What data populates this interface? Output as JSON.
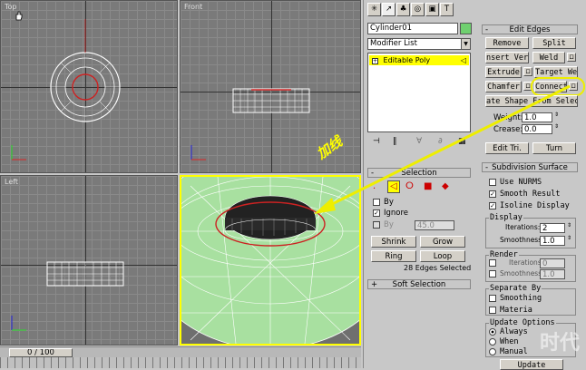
{
  "viewports": {
    "top": {
      "label": "Top"
    },
    "front": {
      "label": "Front"
    },
    "left": {
      "label": "Left"
    }
  },
  "timeline": {
    "frame": "0 / 100"
  },
  "object": {
    "name": "Cylinder01",
    "color": "#6fd06f"
  },
  "modifier_list": {
    "label": "Modifier List"
  },
  "stack": {
    "item": "Editable Poly"
  },
  "annotation": {
    "text": "加线"
  },
  "selection": {
    "title": "Selection",
    "by_vertex": "By",
    "ignore_backfacing": "Ignore",
    "by_angle": "By",
    "angle_value": "45.0",
    "shrink": "Shrink",
    "grow": "Grow",
    "ring": "Ring",
    "loop": "Loop",
    "status": "28 Edges Selected"
  },
  "soft_selection": {
    "title": "Soft Selection"
  },
  "edit_edges": {
    "title": "Edit Edges",
    "remove": "Remove",
    "split": "Split",
    "insert_vertex": "nsert Verte",
    "weld": "Weld",
    "extrude": "Extrude",
    "target_weld": "Target Weld",
    "chamfer": "Chamfer",
    "connect": "Connect",
    "create_shape": "ate Shape From Select",
    "weight_label": "Weight:",
    "weight_value": "1.0",
    "crease_label": "Crease:",
    "crease_value": "0.0",
    "edit_tri": "Edit Tri.",
    "turn": "Turn"
  },
  "subdivision": {
    "title": "Subdivision Surface",
    "use_nurms": "Use NURMS",
    "smooth_result": "Smooth Result",
    "isoline_display": "Isoline Display",
    "display_group": "Display",
    "iterations_label": "Iterations:",
    "iterations_value": "2",
    "smoothness_label": "Smoothness:",
    "smoothness_value": "1.0",
    "render_group": "Render",
    "render_iterations_label": "Iterations:",
    "render_iterations_value": "0",
    "render_smoothness_label": "Smoothness:",
    "render_smoothness_value": "1.0",
    "separate_by": "Separate By",
    "smoothing": "Smoothing",
    "materials": "Materia",
    "update_options": "Update Options",
    "always": "Always",
    "when": "When",
    "manual": "Manual",
    "update": "Update"
  },
  "watermark": {
    "text": "时代"
  }
}
